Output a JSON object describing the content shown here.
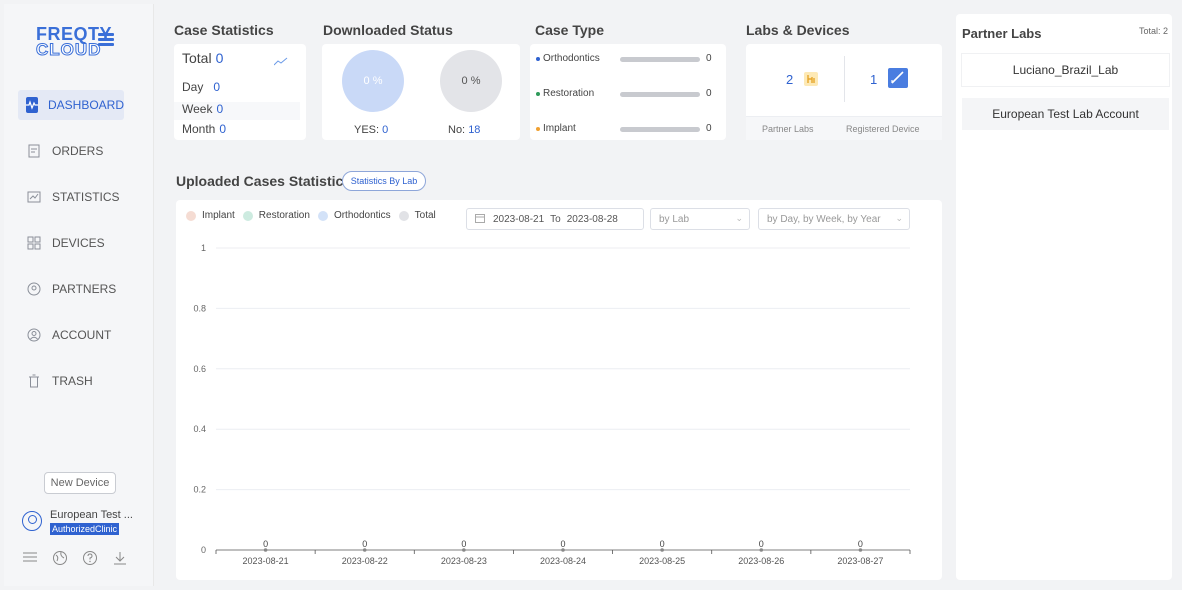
{
  "app": {
    "logo_top": "FREQTY",
    "logo_bottom": "CLOUD"
  },
  "sidebar": {
    "items": [
      {
        "label": "DASHBOARD",
        "icon": "pulse-icon",
        "active": true
      },
      {
        "label": "ORDERS",
        "icon": "orders-icon",
        "active": false
      },
      {
        "label": "STATISTICS",
        "icon": "statistics-icon",
        "active": false
      },
      {
        "label": "DEVICES",
        "icon": "devices-icon",
        "active": false
      },
      {
        "label": "PARTNERS",
        "icon": "partners-icon",
        "active": false
      },
      {
        "label": "ACCOUNT",
        "icon": "account-icon",
        "active": false
      },
      {
        "label": "TRASH",
        "icon": "trash-icon",
        "active": false
      }
    ],
    "new_device_label": "New Device",
    "user_name": "European Test ...",
    "user_role": "AuthorizedClinic",
    "bottom_icons": [
      "menu-icon",
      "globe-icon",
      "help-icon",
      "download-icon"
    ]
  },
  "case_statistics": {
    "title": "Case Statistics",
    "total_label": "Total",
    "total_value": "0",
    "day_label": "Day",
    "day_value": "0",
    "week_label": "Week",
    "week_value": "0",
    "month_label": "Month",
    "month_value": "0"
  },
  "downloaded_status": {
    "title": "Downloaded Status",
    "yes_percent": "0 %",
    "no_percent": "0 %",
    "yes_label": "YES:",
    "yes_value": "0",
    "no_label": "No:",
    "no_value": "18"
  },
  "case_type": {
    "title": "Case Type",
    "rows": [
      {
        "label": "Orthodontics",
        "value": "0",
        "color": "#2f62d0"
      },
      {
        "label": "Restoration",
        "value": "0",
        "color": "#2e9a5a"
      },
      {
        "label": "Implant",
        "value": "0",
        "color": "#f0a030"
      }
    ]
  },
  "labs_devices": {
    "title": "Labs & Devices",
    "partner_labs_count": "2",
    "registered_device_count": "1",
    "partner_labs_label": "Partner Labs",
    "registered_device_label": "Registered Device"
  },
  "partner_labs": {
    "title": "Partner Labs",
    "total_label": "Total:",
    "total_value": "2",
    "items": [
      "Luciano_Brazil_Lab",
      "European Test Lab Account"
    ]
  },
  "uploaded": {
    "title": "Uploaded Cases Statistics",
    "by_lab_button": "Statistics By Lab",
    "legend": [
      {
        "label": "Implant",
        "color": "#f5dcd3"
      },
      {
        "label": "Restoration",
        "color": "#cdebe0"
      },
      {
        "label": "Orthodontics",
        "color": "#d3e2f8"
      },
      {
        "label": "Total",
        "color": "#e1e2e6"
      }
    ],
    "date_from": "2023-08-21",
    "date_to_label": "To",
    "date_to": "2023-08-28",
    "lab_placeholder": "by Lab",
    "period_placeholder": "by Day, by Week, by Year"
  },
  "chart_data": {
    "type": "line",
    "x": [
      "2023-08-21",
      "2023-08-22",
      "2023-08-23",
      "2023-08-24",
      "2023-08-25",
      "2023-08-26",
      "2023-08-27"
    ],
    "series": [
      {
        "name": "Implant",
        "values": [
          0,
          0,
          0,
          0,
          0,
          0,
          0
        ]
      },
      {
        "name": "Restoration",
        "values": [
          0,
          0,
          0,
          0,
          0,
          0,
          0
        ]
      },
      {
        "name": "Orthodontics",
        "values": [
          0,
          0,
          0,
          0,
          0,
          0,
          0
        ]
      },
      {
        "name": "Total",
        "values": [
          0,
          0,
          0,
          0,
          0,
          0,
          0
        ]
      }
    ],
    "y_ticks": [
      "0",
      "0.2",
      "0.4",
      "0.6",
      "0.8",
      "1"
    ],
    "ylim": [
      0,
      1
    ],
    "grid": true,
    "data_labels": [
      "0",
      "0",
      "0",
      "0",
      "0",
      "0",
      "0"
    ]
  }
}
